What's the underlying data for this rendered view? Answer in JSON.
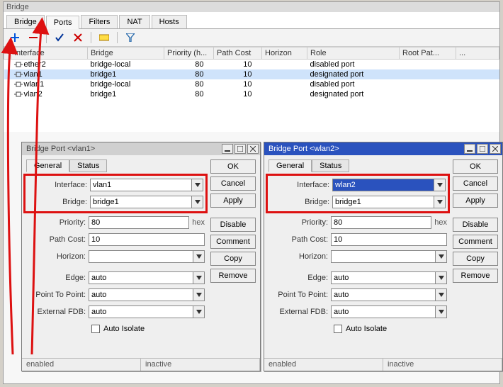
{
  "window_title": "Bridge",
  "tabs": [
    "Bridge",
    "Ports",
    "Filters",
    "NAT",
    "Hosts"
  ],
  "active_tab": 1,
  "columns": [
    "Interface",
    "Bridge",
    "Priority (h...",
    "Path Cost",
    "Horizon",
    "Role",
    "Root Pat..."
  ],
  "col6_blank": "...",
  "rows": [
    {
      "interface": "ether2",
      "bridge": "bridge-local",
      "priority": "80",
      "path_cost": "10",
      "horizon": "",
      "role": "disabled port"
    },
    {
      "interface": "vlan1",
      "bridge": "bridge1",
      "priority": "80",
      "path_cost": "10",
      "horizon": "",
      "role": "designated port",
      "selected": true
    },
    {
      "interface": "wlan1",
      "bridge": "bridge-local",
      "priority": "80",
      "path_cost": "10",
      "horizon": "",
      "role": "disabled port"
    },
    {
      "interface": "vlan2",
      "bridge": "bridge1",
      "priority": "80",
      "path_cost": "10",
      "horizon": "",
      "role": "designated port"
    }
  ],
  "dialog_left": {
    "title": "Bridge Port <vlan1>",
    "tabs": [
      "General",
      "Status"
    ],
    "interface": "vlan1",
    "bridge": "bridge1",
    "priority": "80",
    "path_cost": "10",
    "horizon": "",
    "edge": "auto",
    "ptp": "auto",
    "efdb": "auto",
    "auto_isolate": "Auto Isolate",
    "status_enabled": "enabled",
    "status_inactive": "inactive"
  },
  "dialog_right": {
    "title": "Bridge Port <wlan2>",
    "tabs": [
      "General",
      "Status"
    ],
    "interface": "wlan2",
    "bridge": "bridge1",
    "priority": "80",
    "path_cost": "10",
    "horizon": "",
    "edge": "auto",
    "ptp": "auto",
    "efdb": "auto",
    "auto_isolate": "Auto Isolate",
    "status_enabled": "enabled",
    "status_inactive": "inactive"
  },
  "labels": {
    "interface": "Interface:",
    "bridge": "Bridge:",
    "priority": "Priority:",
    "path_cost": "Path Cost:",
    "horizon": "Horizon:",
    "edge": "Edge:",
    "ptp": "Point To Point:",
    "efdb": "External FDB:",
    "hex": "hex"
  },
  "buttons": {
    "ok": "OK",
    "cancel": "Cancel",
    "apply": "Apply",
    "disable": "Disable",
    "comment": "Comment",
    "copy": "Copy",
    "remove": "Remove"
  }
}
